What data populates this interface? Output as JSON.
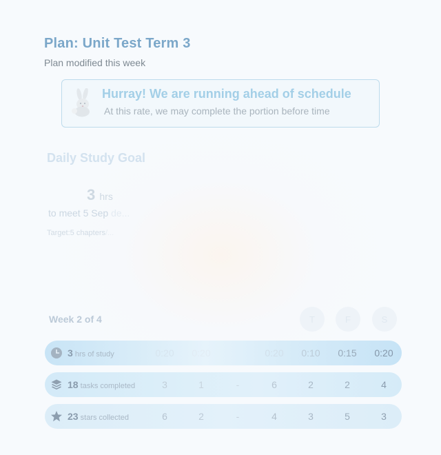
{
  "plan": {
    "title": "Plan: Unit Test Term 3",
    "subtitle": "Plan modified this week"
  },
  "banner": {
    "heading": "Hurray! We are running ahead of schedule",
    "text": "At this rate, we may complete the portion before time"
  },
  "goal": {
    "heading": "Daily Study Goal",
    "hours": "3",
    "hours_unit": "hrs",
    "meet_prefix": "to meet",
    "meet_date_visible": "5 Sep",
    "meet_date_faded": "de...",
    "target_prefix": "Target:",
    "target_visible": "5 chapters",
    "target_faded": "/..."
  },
  "week": {
    "label": "Week",
    "current": "2",
    "of": "of",
    "total": "4",
    "days": [
      "T",
      "F",
      "S"
    ]
  },
  "rows": [
    {
      "icon": "clock-icon",
      "count": "3",
      "label": "hrs of study",
      "values": [
        "0:20",
        "0:20",
        "",
        "0:20",
        "0:10",
        "0:15",
        "0:20"
      ]
    },
    {
      "icon": "layers-icon",
      "count": "18",
      "label": "tasks completed",
      "values": [
        "3",
        "1",
        "-",
        "6",
        "2",
        "2",
        "4"
      ]
    },
    {
      "icon": "star-icon",
      "count": "23",
      "label": "stars collected",
      "values": [
        "6",
        "2",
        "-",
        "4",
        "3",
        "5",
        "3"
      ]
    }
  ],
  "colors": {
    "accent": "#7ba7c9",
    "banner_border": "#bddbec",
    "banner_heading": "#a3cfe7",
    "row_bg": "#d3eaf8"
  }
}
